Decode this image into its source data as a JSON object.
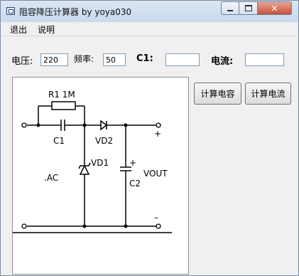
{
  "window": {
    "title": "阻容降压计算器 by yoya030"
  },
  "menu": {
    "items": [
      "退出",
      "说明"
    ]
  },
  "form": {
    "voltage_label": "电压:",
    "voltage_value": "220",
    "frequency_label": "频率:",
    "frequency_value": "50",
    "c1_label": "C1:",
    "c1_value": "",
    "current_label": "电流:",
    "current_value": ""
  },
  "buttons": {
    "calc_capacitance": "计算电容",
    "calc_current": "计算电流"
  },
  "diagram": {
    "labels": {
      "r1": "R1 1M",
      "c1": "C1",
      "vd2": "VD2",
      "vd1": "VD1",
      "ac": ".AC",
      "c2": "C2",
      "vout": "VOUT",
      "plus_cap": "+",
      "plus_out": "+",
      "minus_out": "–"
    }
  }
}
